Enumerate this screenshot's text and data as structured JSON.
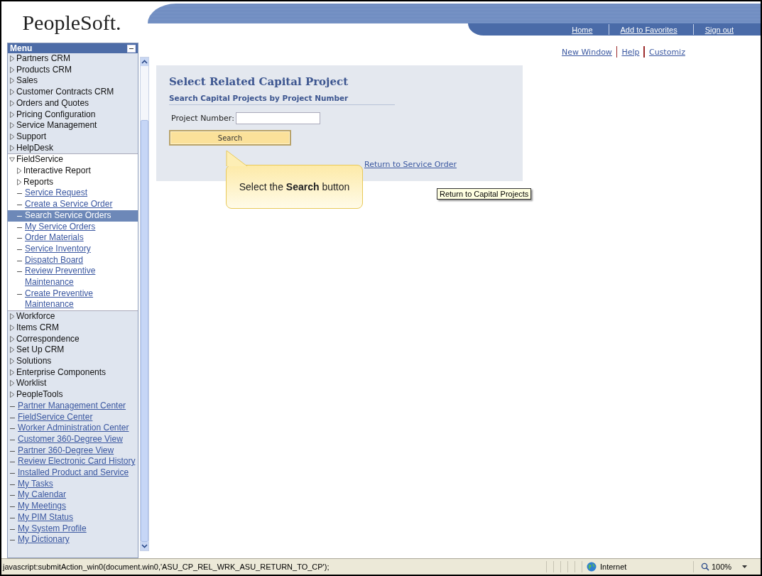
{
  "logo": "PeopleSoft.",
  "header_links": [
    "Home",
    "Add to Favorites",
    "Sign out"
  ],
  "page_links": [
    "New Window",
    "Help",
    "Customiz"
  ],
  "menu": {
    "title": "Menu",
    "items": [
      {
        "label": "Partners CRM",
        "kind": "folder",
        "expanded": false,
        "selected": false
      },
      {
        "label": "Products CRM",
        "kind": "folder",
        "expanded": false,
        "selected": false
      },
      {
        "label": "Sales",
        "kind": "folder",
        "expanded": false,
        "selected": false
      },
      {
        "label": "Customer Contracts CRM",
        "kind": "folder",
        "expanded": false,
        "selected": false
      },
      {
        "label": "Orders and Quotes",
        "kind": "folder",
        "expanded": false,
        "selected": false
      },
      {
        "label": "Pricing Configuration",
        "kind": "folder",
        "expanded": false,
        "selected": false
      },
      {
        "label": "Service Management",
        "kind": "folder",
        "expanded": false,
        "selected": false
      },
      {
        "label": "Support",
        "kind": "folder",
        "expanded": false,
        "selected": false
      },
      {
        "label": "HelpDesk",
        "kind": "folder",
        "expanded": false,
        "selected": false
      },
      {
        "label": "FieldService",
        "kind": "folder",
        "expanded": true,
        "selected": false,
        "children": [
          {
            "label": "Interactive Report",
            "kind": "folder",
            "expanded": false,
            "selected": false
          },
          {
            "label": "Reports",
            "kind": "folder",
            "expanded": false,
            "selected": false
          },
          {
            "label": "Service Request",
            "kind": "link",
            "selected": false
          },
          {
            "label": "Create a Service Order",
            "kind": "link",
            "selected": false
          },
          {
            "label": "Search Service Orders",
            "kind": "link",
            "selected": true
          },
          {
            "label": "My Service Orders",
            "kind": "link",
            "selected": false
          },
          {
            "label": "Order Materials",
            "kind": "link",
            "selected": false
          },
          {
            "label": "Service Inventory",
            "kind": "link",
            "selected": false
          },
          {
            "label": "Dispatch Board",
            "kind": "link",
            "selected": false
          },
          {
            "label": "Review Preventive Maintenance",
            "kind": "link",
            "selected": false
          },
          {
            "label": "Create Preventive Maintenance",
            "kind": "link",
            "selected": false
          }
        ]
      },
      {
        "label": "Workforce",
        "kind": "folder",
        "expanded": false,
        "selected": false
      },
      {
        "label": "Items CRM",
        "kind": "folder",
        "expanded": false,
        "selected": false
      },
      {
        "label": "Correspondence",
        "kind": "folder",
        "expanded": false,
        "selected": false
      },
      {
        "label": "Set Up CRM",
        "kind": "folder",
        "expanded": false,
        "selected": false
      },
      {
        "label": "Solutions",
        "kind": "folder",
        "expanded": false,
        "selected": false
      },
      {
        "label": "Enterprise Components",
        "kind": "folder",
        "expanded": false,
        "selected": false
      },
      {
        "label": "Worklist",
        "kind": "folder",
        "expanded": false,
        "selected": false
      },
      {
        "label": "PeopleTools",
        "kind": "folder",
        "expanded": false,
        "selected": false
      },
      {
        "label": "Partner Management Center",
        "kind": "link",
        "selected": false
      },
      {
        "label": "FieldService Center",
        "kind": "link",
        "selected": false
      },
      {
        "label": "Worker Administration Center",
        "kind": "link",
        "selected": false
      },
      {
        "label": "Customer 360-Degree View",
        "kind": "link",
        "selected": false
      },
      {
        "label": "Partner 360-Degree View",
        "kind": "link",
        "selected": false
      },
      {
        "label": "Review Electronic Card History",
        "kind": "link",
        "selected": false
      },
      {
        "label": "Installed Product and Service",
        "kind": "link",
        "selected": false
      },
      {
        "label": "My Tasks",
        "kind": "link",
        "selected": false
      },
      {
        "label": "My Calendar",
        "kind": "link",
        "selected": false
      },
      {
        "label": "My Meetings",
        "kind": "link",
        "selected": false
      },
      {
        "label": "My PIM Status",
        "kind": "link",
        "selected": false
      },
      {
        "label": "My System Profile",
        "kind": "link",
        "selected": false
      },
      {
        "label": "My Dictionary",
        "kind": "link",
        "selected": false
      }
    ]
  },
  "panel": {
    "title": "Select Related Capital Project",
    "subtitle": "Search Capital Projects by Project Number",
    "field_label": "Project Number:",
    "button": "Search",
    "link": "Return to Service Order"
  },
  "callout": "Select the **Search** button",
  "tooltip": "Return to Capital Projects",
  "status_bar": {
    "text": "javascript:submitAction_win0(document.win0,'ASU_CP_REL_WRK_ASU_RETURN_TO_CP');",
    "zone": "Internet",
    "zoom": "100%"
  }
}
